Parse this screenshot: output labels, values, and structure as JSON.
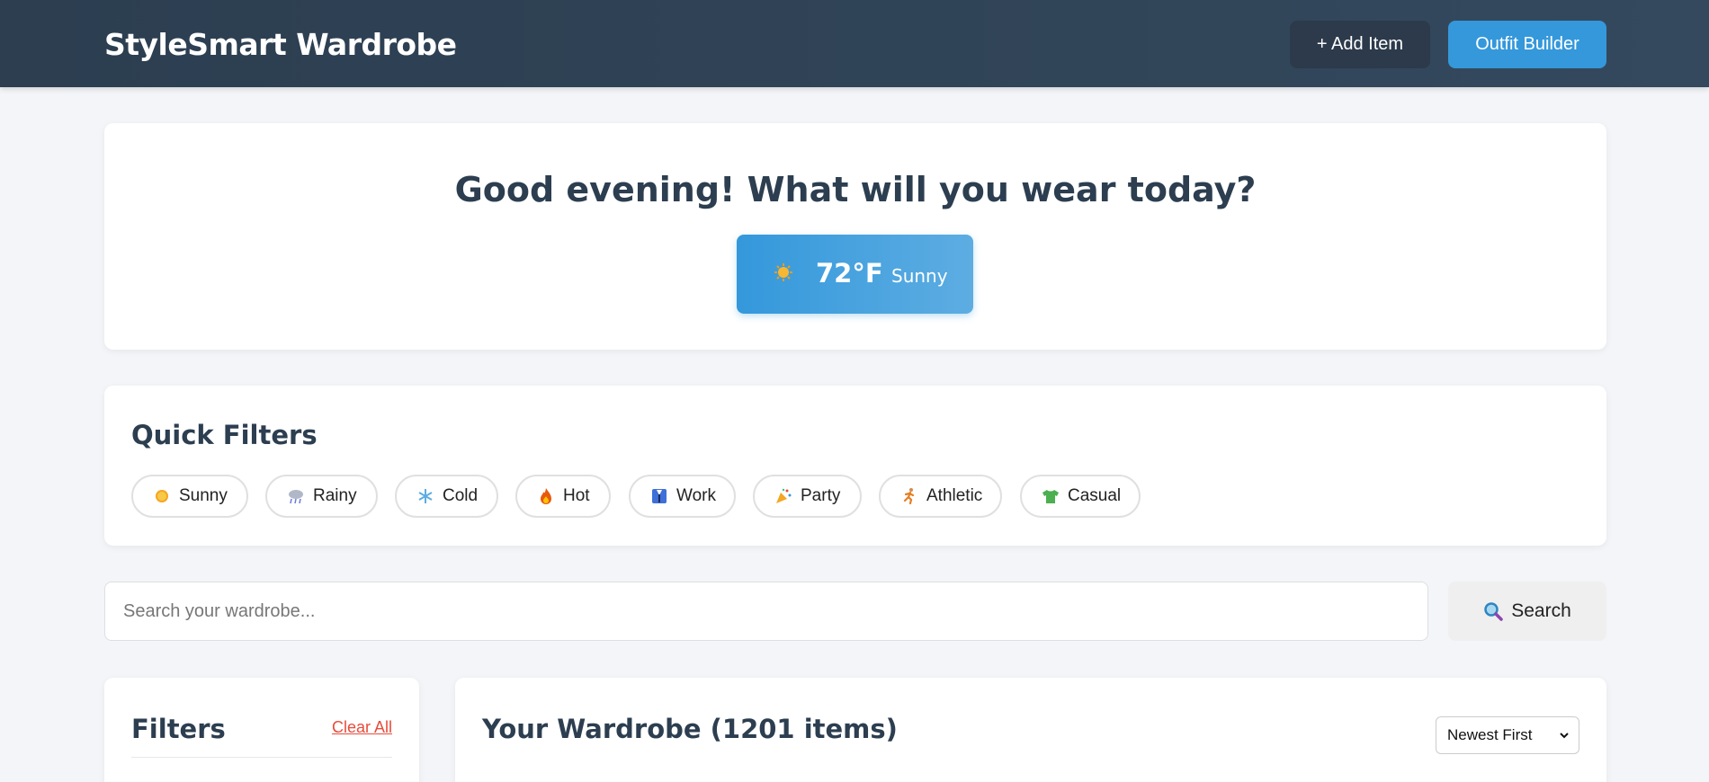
{
  "header": {
    "brand": "StyleSmart Wardrobe",
    "add_item_label": "+ Add Item",
    "outfit_builder_label": "Outfit Builder"
  },
  "hero": {
    "greeting": "Good evening! What will you wear today?",
    "weather": {
      "icon": "sun-icon",
      "temperature": "72°F",
      "condition": "Sunny"
    }
  },
  "quick_filters": {
    "title": "Quick Filters",
    "chips": [
      {
        "label": "Sunny",
        "icon": "sun-icon"
      },
      {
        "label": "Rainy",
        "icon": "rain-cloud-icon"
      },
      {
        "label": "Cold",
        "icon": "snowflake-icon"
      },
      {
        "label": "Hot",
        "icon": "fire-icon"
      },
      {
        "label": "Work",
        "icon": "suit-icon"
      },
      {
        "label": "Party",
        "icon": "party-popper-icon"
      },
      {
        "label": "Athletic",
        "icon": "runner-icon"
      },
      {
        "label": "Casual",
        "icon": "tshirt-icon"
      }
    ]
  },
  "search": {
    "placeholder": "Search your wardrobe...",
    "value": "",
    "button_label": "Search",
    "button_icon": "magnifier-icon"
  },
  "sidebar": {
    "title": "Filters",
    "clear_all_label": "Clear All"
  },
  "wardrobe": {
    "title": "Your Wardrobe (1201 items)",
    "sort_selected": "Newest First"
  },
  "colors": {
    "header_bg": "#2c3e50",
    "accent": "#3498db",
    "clear_link": "#e74c3c",
    "page_bg": "#f3f5f8"
  }
}
